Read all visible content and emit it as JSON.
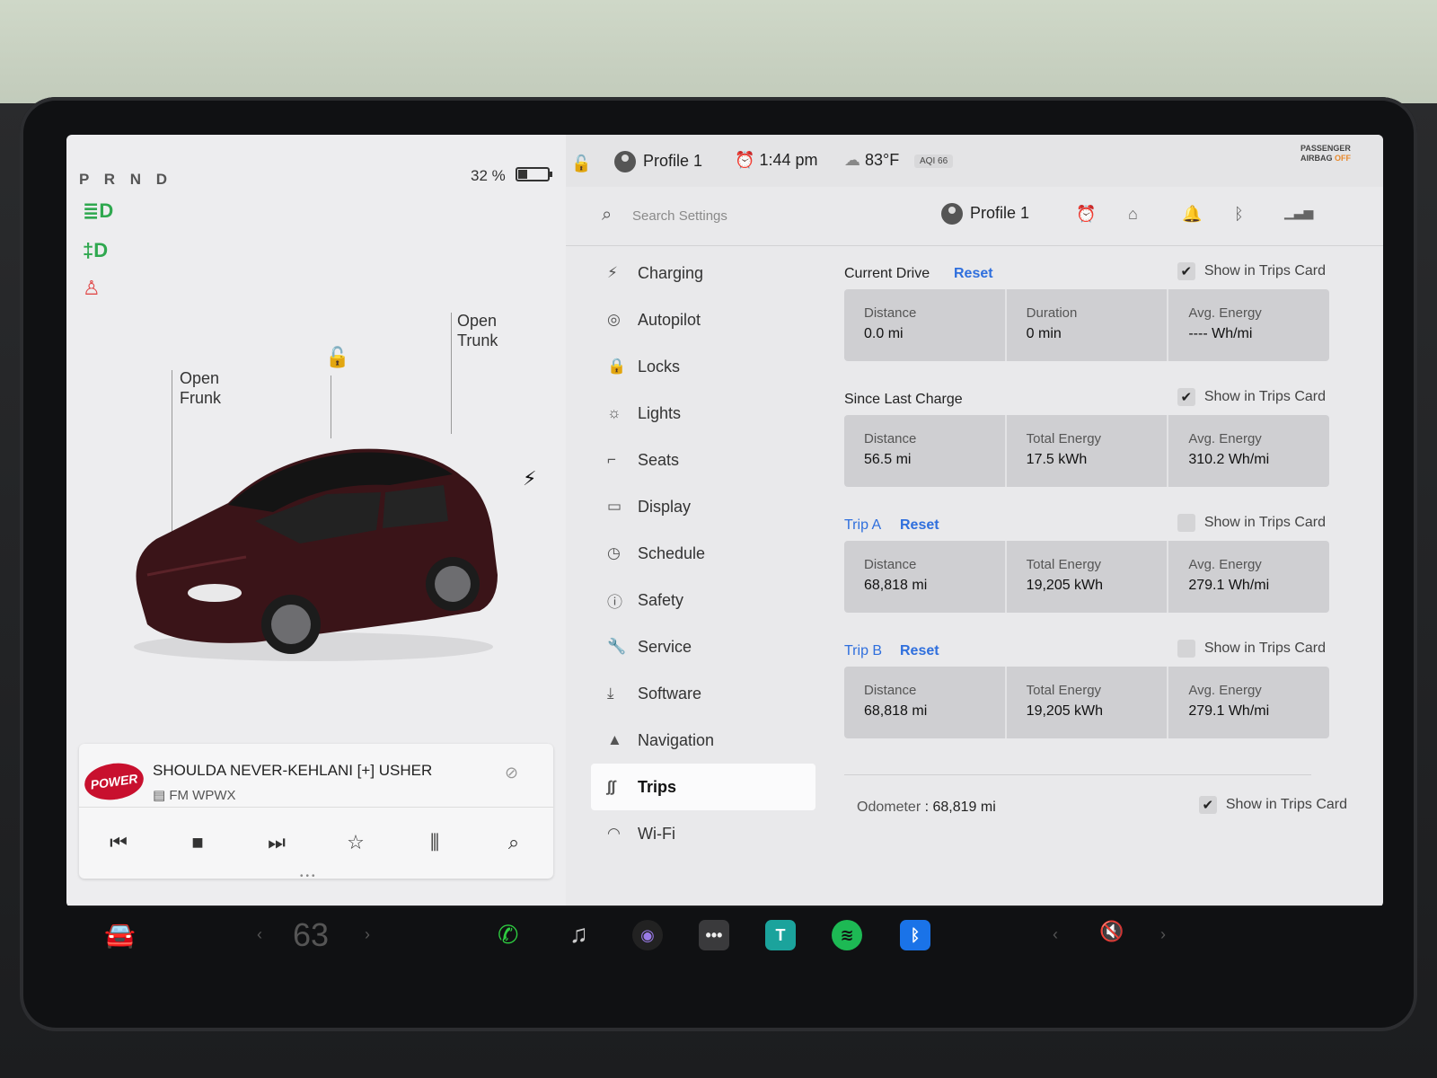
{
  "vehicle": {
    "gear": "P R N D",
    "battery_pct": "32 %",
    "battery_level": 0.32,
    "open_frunk": [
      "Open",
      "Frunk"
    ],
    "open_trunk": [
      "Open",
      "Trunk"
    ],
    "icons": [
      "low-beam-icon",
      "fog-light-icon",
      "seatbelt-warning-icon",
      "unlock-icon",
      "charge-port-bolt-icon"
    ]
  },
  "media": {
    "song": "SHOULDA NEVER-KEHLANI [+] USHER",
    "station": "FM WPWX",
    "logo_text": "POWER",
    "controls": [
      "previous-icon",
      "stop-icon",
      "next-icon",
      "favorite-star-icon",
      "equalizer-icon",
      "search-icon"
    ]
  },
  "status": {
    "profile": "Profile 1",
    "time": "1:44 pm",
    "temp": "83°F",
    "aqi": "AQI 66",
    "airbag_line1": "PASSENGER",
    "airbag_line2": "AIRBAG",
    "airbag_state": "OFF"
  },
  "header": {
    "search_placeholder": "Search Settings",
    "profile": "Profile 1"
  },
  "nav": [
    {
      "label": "Charging",
      "icon": "⚡"
    },
    {
      "label": "Autopilot",
      "icon": "◎"
    },
    {
      "label": "Locks",
      "icon": "🔒"
    },
    {
      "label": "Lights",
      "icon": "☼"
    },
    {
      "label": "Seats",
      "icon": "⌐"
    },
    {
      "label": "Display",
      "icon": "▭"
    },
    {
      "label": "Schedule",
      "icon": "◷"
    },
    {
      "label": "Safety",
      "icon": "ⓘ"
    },
    {
      "label": "Service",
      "icon": "🔧"
    },
    {
      "label": "Software",
      "icon": "⤓"
    },
    {
      "label": "Navigation",
      "icon": "▲"
    },
    {
      "label": "Trips",
      "icon": "∫∫"
    },
    {
      "label": "Wi-Fi",
      "icon": "◠"
    }
  ],
  "trips": {
    "show_label": "Show in Trips Card",
    "reset_label": "Reset",
    "current_drive": {
      "title": "Current Drive",
      "checked": "✔",
      "cards": [
        {
          "label": "Distance",
          "value": "0.0 mi"
        },
        {
          "label": "Duration",
          "value": "0 min"
        },
        {
          "label": "Avg. Energy",
          "value": "---- Wh/mi"
        }
      ]
    },
    "since_last_charge": {
      "title": "Since Last Charge",
      "checked": "✔",
      "cards": [
        {
          "label": "Distance",
          "value": "56.5 mi"
        },
        {
          "label": "Total Energy",
          "value": "17.5 kWh"
        },
        {
          "label": "Avg. Energy",
          "value": "310.2 Wh/mi"
        }
      ]
    },
    "trip_a": {
      "title": "Trip A",
      "checked": "",
      "cards": [
        {
          "label": "Distance",
          "value": "68,818 mi"
        },
        {
          "label": "Total Energy",
          "value": "19,205 kWh"
        },
        {
          "label": "Avg. Energy",
          "value": "279.1 Wh/mi"
        }
      ]
    },
    "trip_b": {
      "title": "Trip B",
      "checked": "",
      "cards": [
        {
          "label": "Distance",
          "value": "68,818 mi"
        },
        {
          "label": "Total Energy",
          "value": "19,205 kWh"
        },
        {
          "label": "Avg. Energy",
          "value": "279.1 Wh/mi"
        }
      ]
    },
    "odometer_label": "Odometer",
    "odometer_sep": ":",
    "odometer_value": "68,819 mi",
    "odometer_checked": "✔"
  },
  "dock": {
    "cabin_temp": "63",
    "apps": [
      "car-icon",
      "phone-icon",
      "music-icon",
      "camera-icon",
      "more-icon",
      "toybox-icon",
      "spotify-icon",
      "bluetooth-icon",
      "volume-muted-icon"
    ]
  },
  "colors": {
    "accent_blue": "#2f6fdd",
    "alarm_orange": "#e8892c",
    "tell_green": "#2fa84f",
    "tell_red": "#e04a4a"
  }
}
